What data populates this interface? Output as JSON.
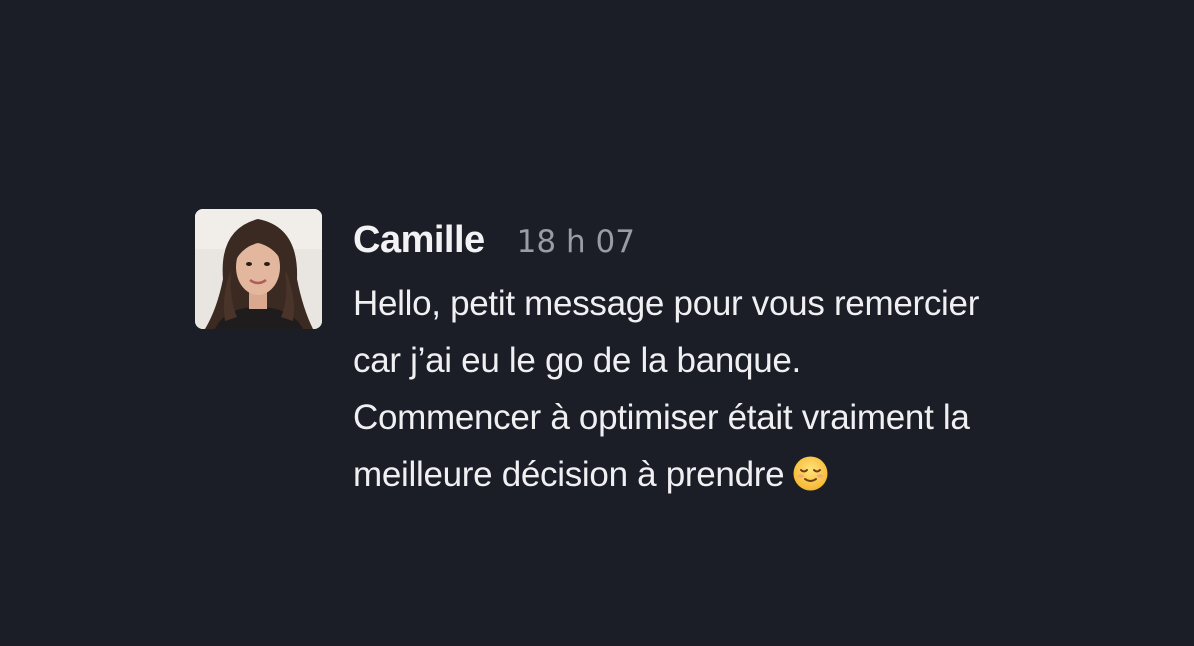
{
  "message": {
    "author": "Camille",
    "timestamp": "18 h 07",
    "lines": [
      "Hello, petit message pour vous remercier",
      "car j’ai eu le go de la banque.",
      "Commencer à optimiser était vraiment la",
      "meilleure décision à prendre"
    ],
    "emoji": "relieved-face-icon"
  },
  "colors": {
    "background": "#1b1d27",
    "author": "#f2f2f4",
    "timestamp": "#9a9ba3",
    "text": "#f0f0f2"
  }
}
